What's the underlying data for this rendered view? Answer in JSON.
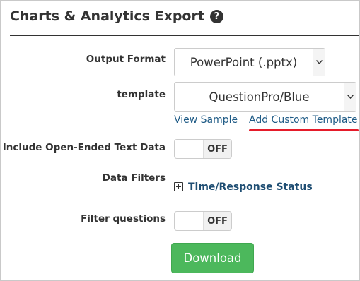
{
  "header": {
    "title": "Charts & Analytics Export",
    "help_icon": "?"
  },
  "form": {
    "output_format": {
      "label": "Output Format",
      "value": "PowerPoint (.pptx)"
    },
    "template": {
      "label": "template",
      "value": "QuestionPro/Blue",
      "view_sample": "View Sample",
      "add_custom": "Add Custom Template",
      "highlight_color": "#e51b2a"
    },
    "open_ended": {
      "label": "Include Open-Ended Text Data",
      "state": "OFF"
    },
    "data_filters": {
      "label": "Data Filters",
      "item": "Time/Response Status"
    },
    "filter_questions": {
      "label": "Filter questions",
      "state": "OFF"
    }
  },
  "actions": {
    "download_label": "Download",
    "download_color": "#4cb85c"
  }
}
